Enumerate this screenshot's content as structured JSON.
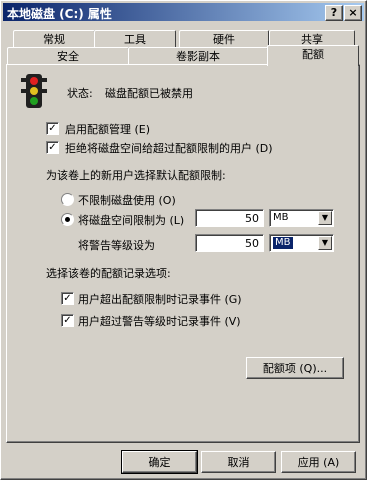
{
  "window": {
    "title": "本地磁盘 (C:) 属性",
    "help_btn": "?",
    "close_btn": "×"
  },
  "tabs_row1": [
    {
      "label": "常规"
    },
    {
      "label": "工具"
    },
    {
      "label": "硬件"
    },
    {
      "label": "共享"
    }
  ],
  "tabs_row2": [
    {
      "label": "安全"
    },
    {
      "label": "卷影副本"
    },
    {
      "label": "配额",
      "active": true
    }
  ],
  "status": {
    "label": "状态:",
    "text": "磁盘配额已被禁用"
  },
  "options": {
    "enable_quota": {
      "label": "启用配额管理 (E)",
      "checked": true
    },
    "deny_space": {
      "label": "拒绝将磁盘空间给超过配额限制的用户 (D)",
      "checked": true
    }
  },
  "default_limit": {
    "heading": "为该卷上的新用户选择默认配额限制:",
    "no_limit_label": "不限制磁盘使用 (O)",
    "limit_label": "将磁盘空间限制为 (L)",
    "limit_value": "50",
    "limit_unit": "MB",
    "warning_label": "将警告等级设为",
    "warning_value": "50",
    "warning_unit": "MB"
  },
  "logging": {
    "heading": "选择该卷的配额记录选项:",
    "log_exceed_label": "用户超出配额限制时记录事件 (G)",
    "log_warning_label": "用户超过警告等级时记录事件 (V)"
  },
  "quota_entries_button": "配额项 (Q)...",
  "footer": {
    "ok": "确定",
    "cancel": "取消",
    "apply": "应用 (A)"
  },
  "colors": {
    "title_start": "#0a246a",
    "title_end": "#a6caf0",
    "face": "#d4d0c8"
  }
}
